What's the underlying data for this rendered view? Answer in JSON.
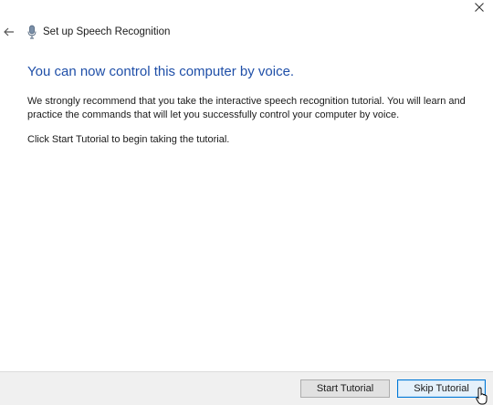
{
  "window": {
    "title": "Set up Speech Recognition",
    "close_icon": "close-icon",
    "back_icon": "back-arrow-icon",
    "app_icon": "microphone-icon"
  },
  "main": {
    "heading": "You can now control this computer by voice.",
    "paragraph1": "We strongly recommend that you take the interactive speech recognition tutorial. You will learn and practice the commands that will let you successfully control your computer by voice.",
    "paragraph2": "Click Start Tutorial to begin taking the tutorial."
  },
  "footer": {
    "start_tutorial_label": "Start Tutorial",
    "skip_tutorial_label": "Skip Tutorial"
  },
  "colors": {
    "heading": "#1f4fa8",
    "footer_bg": "#f0f0f0",
    "focused_button_border": "#0078d7"
  }
}
